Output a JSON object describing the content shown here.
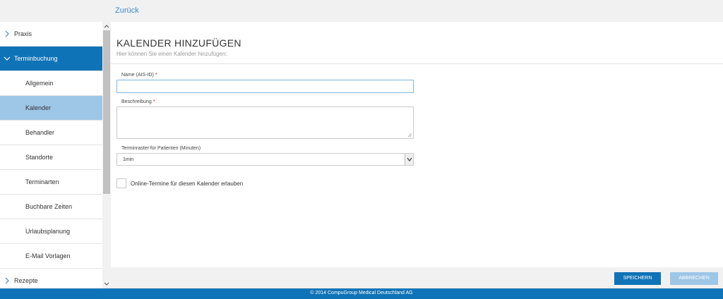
{
  "topbar": {
    "back_label": "Zurück"
  },
  "sidebar": {
    "items": [
      {
        "label": "Praxis",
        "level": "top",
        "state": "collapsed"
      },
      {
        "label": "Terminbuchung",
        "level": "top",
        "state": "expanded"
      },
      {
        "label": "Allgemein",
        "level": "sub",
        "state": "normal"
      },
      {
        "label": "Kalender",
        "level": "sub",
        "state": "active"
      },
      {
        "label": "Behandler",
        "level": "sub",
        "state": "normal"
      },
      {
        "label": "Standorte",
        "level": "sub",
        "state": "normal"
      },
      {
        "label": "Terminarten",
        "level": "sub",
        "state": "normal"
      },
      {
        "label": "Buchbare Zeiten",
        "level": "sub",
        "state": "normal"
      },
      {
        "label": "Urlaubsplanung",
        "level": "sub",
        "state": "normal"
      },
      {
        "label": "E-Mail Vorlagen",
        "level": "sub",
        "state": "normal"
      },
      {
        "label": "Rezepte",
        "level": "top",
        "state": "collapsed"
      }
    ]
  },
  "main": {
    "title": "KALENDER HINZUFÜGEN",
    "subtitle": "Hier können Sie einen Kalender hinzufügen:",
    "name_field": {
      "label": "Name (AIS-ID)",
      "required_mark": "*",
      "value": ""
    },
    "description_field": {
      "label": "Beschreibung",
      "required_mark": "*",
      "value": ""
    },
    "raster_field": {
      "label": "Terminraster für Patienten (Minuten)",
      "selected": "1min"
    },
    "online_checkbox": {
      "label": "Online-Termine für diesen Kalender erlauben",
      "checked": false
    }
  },
  "actions": {
    "save_label": "SPEICHERN",
    "cancel_label": "ABBRECHEN"
  },
  "footer": {
    "copyright": "© 2014 CompuGroup Medical Deutschland AG"
  },
  "colors": {
    "primary": "#0f73b7",
    "active_light": "#9ec6e6",
    "link": "#3f87c8"
  },
  "icons": {
    "collapsed": "chevron-right-icon",
    "expanded": "chevron-down-icon"
  }
}
